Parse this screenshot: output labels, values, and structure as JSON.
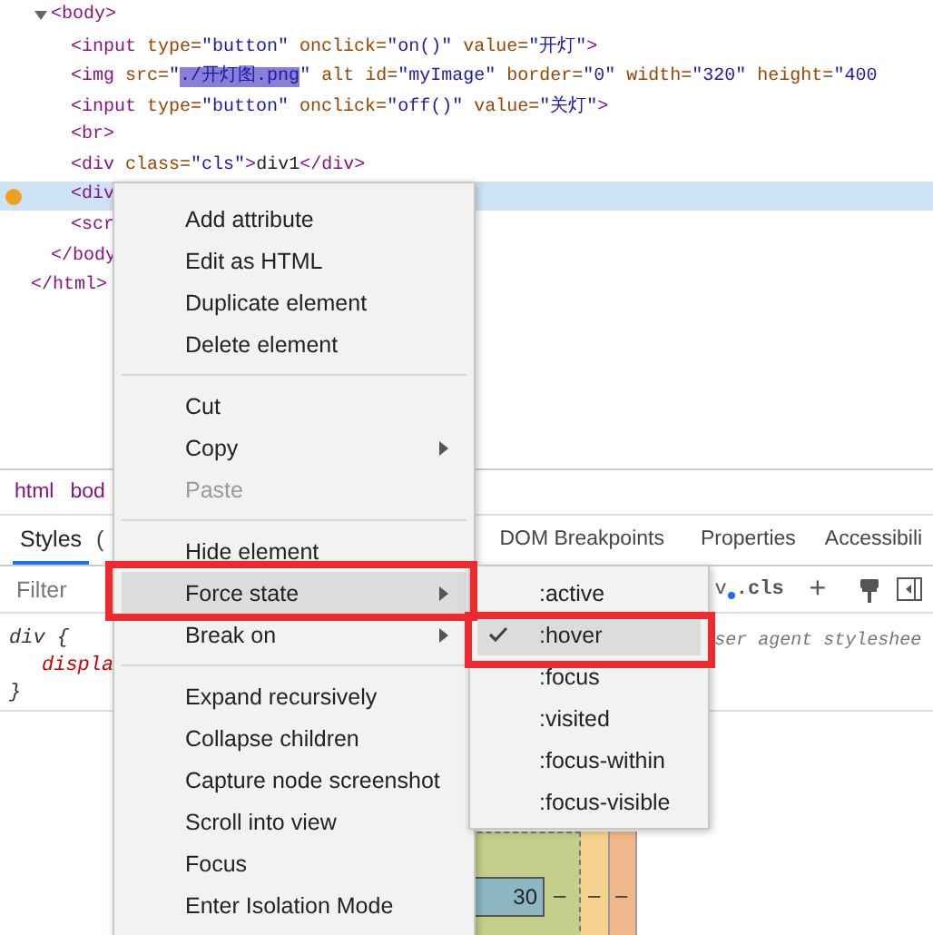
{
  "elements_tree": {
    "nodes": [
      {
        "close": [
          {
            "kind": "tag",
            "text": "</html>"
          }
        ],
        "children": [
          {
            "open": [
              {
                "kind": "tag",
                "text": "<body>"
              }
            ],
            "expanded": true,
            "close": [
              {
                "kind": "tag",
                "text": "</body"
              }
            ],
            "children": [
              {
                "open": [
                  {
                    "kind": "tag",
                    "text": "<input"
                  },
                  {
                    "kind": "attr",
                    "text": " type="
                  },
                  {
                    "kind": "value",
                    "text": "\"button\""
                  },
                  {
                    "kind": "attr",
                    "text": " onclick="
                  },
                  {
                    "kind": "value",
                    "text": "\"on()\""
                  },
                  {
                    "kind": "attr",
                    "text": " value="
                  },
                  {
                    "kind": "value",
                    "text": "\"开灯\""
                  },
                  {
                    "kind": "tag",
                    "text": ">"
                  }
                ],
                "selected": false,
                "marker": false
              },
              {
                "open": [
                  {
                    "kind": "tag",
                    "text": "<img"
                  },
                  {
                    "kind": "attr",
                    "text": " src="
                  },
                  {
                    "kind": "value",
                    "text": "\""
                  },
                  {
                    "kind": "highlight",
                    "text": "./开灯图.png"
                  },
                  {
                    "kind": "value",
                    "text": "\""
                  },
                  {
                    "kind": "attr",
                    "text": " alt id="
                  },
                  {
                    "kind": "value",
                    "text": "\"myImage\""
                  },
                  {
                    "kind": "attr",
                    "text": " border="
                  },
                  {
                    "kind": "value",
                    "text": "\"0\""
                  },
                  {
                    "kind": "attr",
                    "text": " width="
                  },
                  {
                    "kind": "value",
                    "text": "\"320\""
                  },
                  {
                    "kind": "attr",
                    "text": " height="
                  },
                  {
                    "kind": "value",
                    "text": "\"400"
                  }
                ],
                "selected": false,
                "marker": false
              },
              {
                "open": [
                  {
                    "kind": "tag",
                    "text": "<input"
                  },
                  {
                    "kind": "attr",
                    "text": " type="
                  },
                  {
                    "kind": "value",
                    "text": "\"button\""
                  },
                  {
                    "kind": "attr",
                    "text": " onclick="
                  },
                  {
                    "kind": "value",
                    "text": "\"off()\""
                  },
                  {
                    "kind": "attr",
                    "text": " value="
                  },
                  {
                    "kind": "value",
                    "text": "\"关灯\""
                  },
                  {
                    "kind": "tag",
                    "text": ">"
                  }
                ],
                "selected": false,
                "marker": false
              },
              {
                "open": [
                  {
                    "kind": "tag",
                    "text": "<br>"
                  }
                ],
                "selected": false,
                "marker": false
              },
              {
                "open": [
                  {
                    "kind": "tag",
                    "text": "<div"
                  },
                  {
                    "kind": "attr",
                    "text": " class="
                  },
                  {
                    "kind": "value",
                    "text": "\"cls\""
                  },
                  {
                    "kind": "tag",
                    "text": ">"
                  },
                  {
                    "kind": "text",
                    "text": "div1"
                  },
                  {
                    "kind": "tag",
                    "text": "</div>"
                  }
                ],
                "selected": false,
                "marker": false
              },
              {
                "open": [
                  {
                    "kind": "tag",
                    "text": "<div"
                  }
                ],
                "selected": true,
                "marker": true
              },
              {
                "open": [
                  {
                    "kind": "tag",
                    "text": "<scr"
                  }
                ],
                "selected": false,
                "marker": false
              }
            ]
          }
        ]
      }
    ]
  },
  "breadcrumbs": [
    "html",
    "bod"
  ],
  "tabs": [
    {
      "label": "Styles",
      "selected": true
    },
    {
      "label": "(",
      "selected": false
    },
    {
      "label": "DOM Breakpoints",
      "selected": false
    },
    {
      "label": "Properties",
      "selected": false
    },
    {
      "label": "Accessibili",
      "selected": false
    }
  ],
  "filter": {
    "placeholder": "Filter",
    "hov_fragment": "v",
    "cls": ".cls",
    "add": "+"
  },
  "styles": {
    "selector": "div {",
    "property": "displa",
    "close": "}",
    "source": "ser agent styleshee"
  },
  "box_model": {
    "content": "30",
    "dashes": [
      "–",
      "–",
      "–"
    ]
  },
  "context_menu": [
    {
      "kind": "item",
      "label": "Add attribute",
      "submenu": false,
      "disabled": false,
      "selected": false
    },
    {
      "kind": "item",
      "label": "Edit as HTML",
      "submenu": false,
      "disabled": false,
      "selected": false
    },
    {
      "kind": "item",
      "label": "Duplicate element",
      "submenu": false,
      "disabled": false,
      "selected": false
    },
    {
      "kind": "item",
      "label": "Delete element",
      "submenu": false,
      "disabled": false,
      "selected": false
    },
    {
      "kind": "separator"
    },
    {
      "kind": "item",
      "label": "Cut",
      "submenu": false,
      "disabled": false,
      "selected": false
    },
    {
      "kind": "item",
      "label": "Copy",
      "submenu": true,
      "disabled": false,
      "selected": false
    },
    {
      "kind": "item",
      "label": "Paste",
      "submenu": false,
      "disabled": true,
      "selected": false
    },
    {
      "kind": "separator"
    },
    {
      "kind": "item",
      "label": "Hide element",
      "submenu": false,
      "disabled": false,
      "selected": false
    },
    {
      "kind": "item",
      "label": "Force state",
      "submenu": true,
      "disabled": false,
      "selected": true
    },
    {
      "kind": "item",
      "label": "Break on",
      "submenu": true,
      "disabled": false,
      "selected": false
    },
    {
      "kind": "separator"
    },
    {
      "kind": "item",
      "label": "Expand recursively",
      "submenu": false,
      "disabled": false,
      "selected": false
    },
    {
      "kind": "item",
      "label": "Collapse children",
      "submenu": false,
      "disabled": false,
      "selected": false
    },
    {
      "kind": "item",
      "label": "Capture node screenshot",
      "submenu": false,
      "disabled": false,
      "selected": false
    },
    {
      "kind": "item",
      "label": "Scroll into view",
      "submenu": false,
      "disabled": false,
      "selected": false
    },
    {
      "kind": "item",
      "label": "Focus",
      "submenu": false,
      "disabled": false,
      "selected": false
    },
    {
      "kind": "item",
      "label": "Enter Isolation Mode",
      "submenu": false,
      "disabled": false,
      "selected": false
    }
  ],
  "force_state_menu": [
    {
      "label": ":active",
      "checked": false,
      "selected": false
    },
    {
      "label": ":hover",
      "checked": true,
      "selected": true
    },
    {
      "label": ":focus",
      "checked": false,
      "selected": false
    },
    {
      "label": ":visited",
      "checked": false,
      "selected": false
    },
    {
      "label": ":focus-within",
      "checked": false,
      "selected": false
    },
    {
      "label": ":focus-visible",
      "checked": false,
      "selected": false
    }
  ]
}
